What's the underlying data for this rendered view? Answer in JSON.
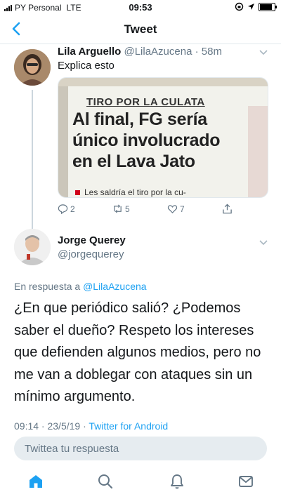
{
  "status_bar": {
    "carrier": "PY Personal",
    "network": "LTE",
    "time": "09:53"
  },
  "nav": {
    "title": "Tweet"
  },
  "parent_tweet": {
    "name": "Lila Arguello",
    "handle": "@LilaAzucena",
    "age": "58m",
    "text": "Explica esto",
    "media": {
      "kicker": "TIRO POR LA CULATA",
      "headline_lines": [
        "Al final, FG sería",
        "único involucrado",
        "en el Lava Jato"
      ],
      "subtext": "Les saldría el tiro por la cu-"
    },
    "replies": "2",
    "retweets": "5",
    "likes": "7"
  },
  "main_tweet": {
    "name": "Jorge Querey",
    "handle": "@jorgequerey",
    "reply_prefix": "En respuesta a",
    "reply_handle": "@LilaAzucena",
    "text_lines": [
      "¿En que periódico salió? ¿Podemos",
      "saber el dueño? Respeto los intereses",
      "que defienden algunos medios, pero no",
      "me van a doblegar con ataques sin un",
      "mínimo argumento."
    ],
    "timestamp": "09:14 · 23/5/19 ·",
    "source": "Twitter for Android"
  },
  "reply_box": {
    "placeholder": "Twittea tu respuesta"
  },
  "tabbar": {
    "icons": [
      "home-icon",
      "search-icon",
      "notifications-icon",
      "messages-icon"
    ]
  },
  "colors": {
    "accent": "#1da1f2",
    "muted": "#657786"
  }
}
